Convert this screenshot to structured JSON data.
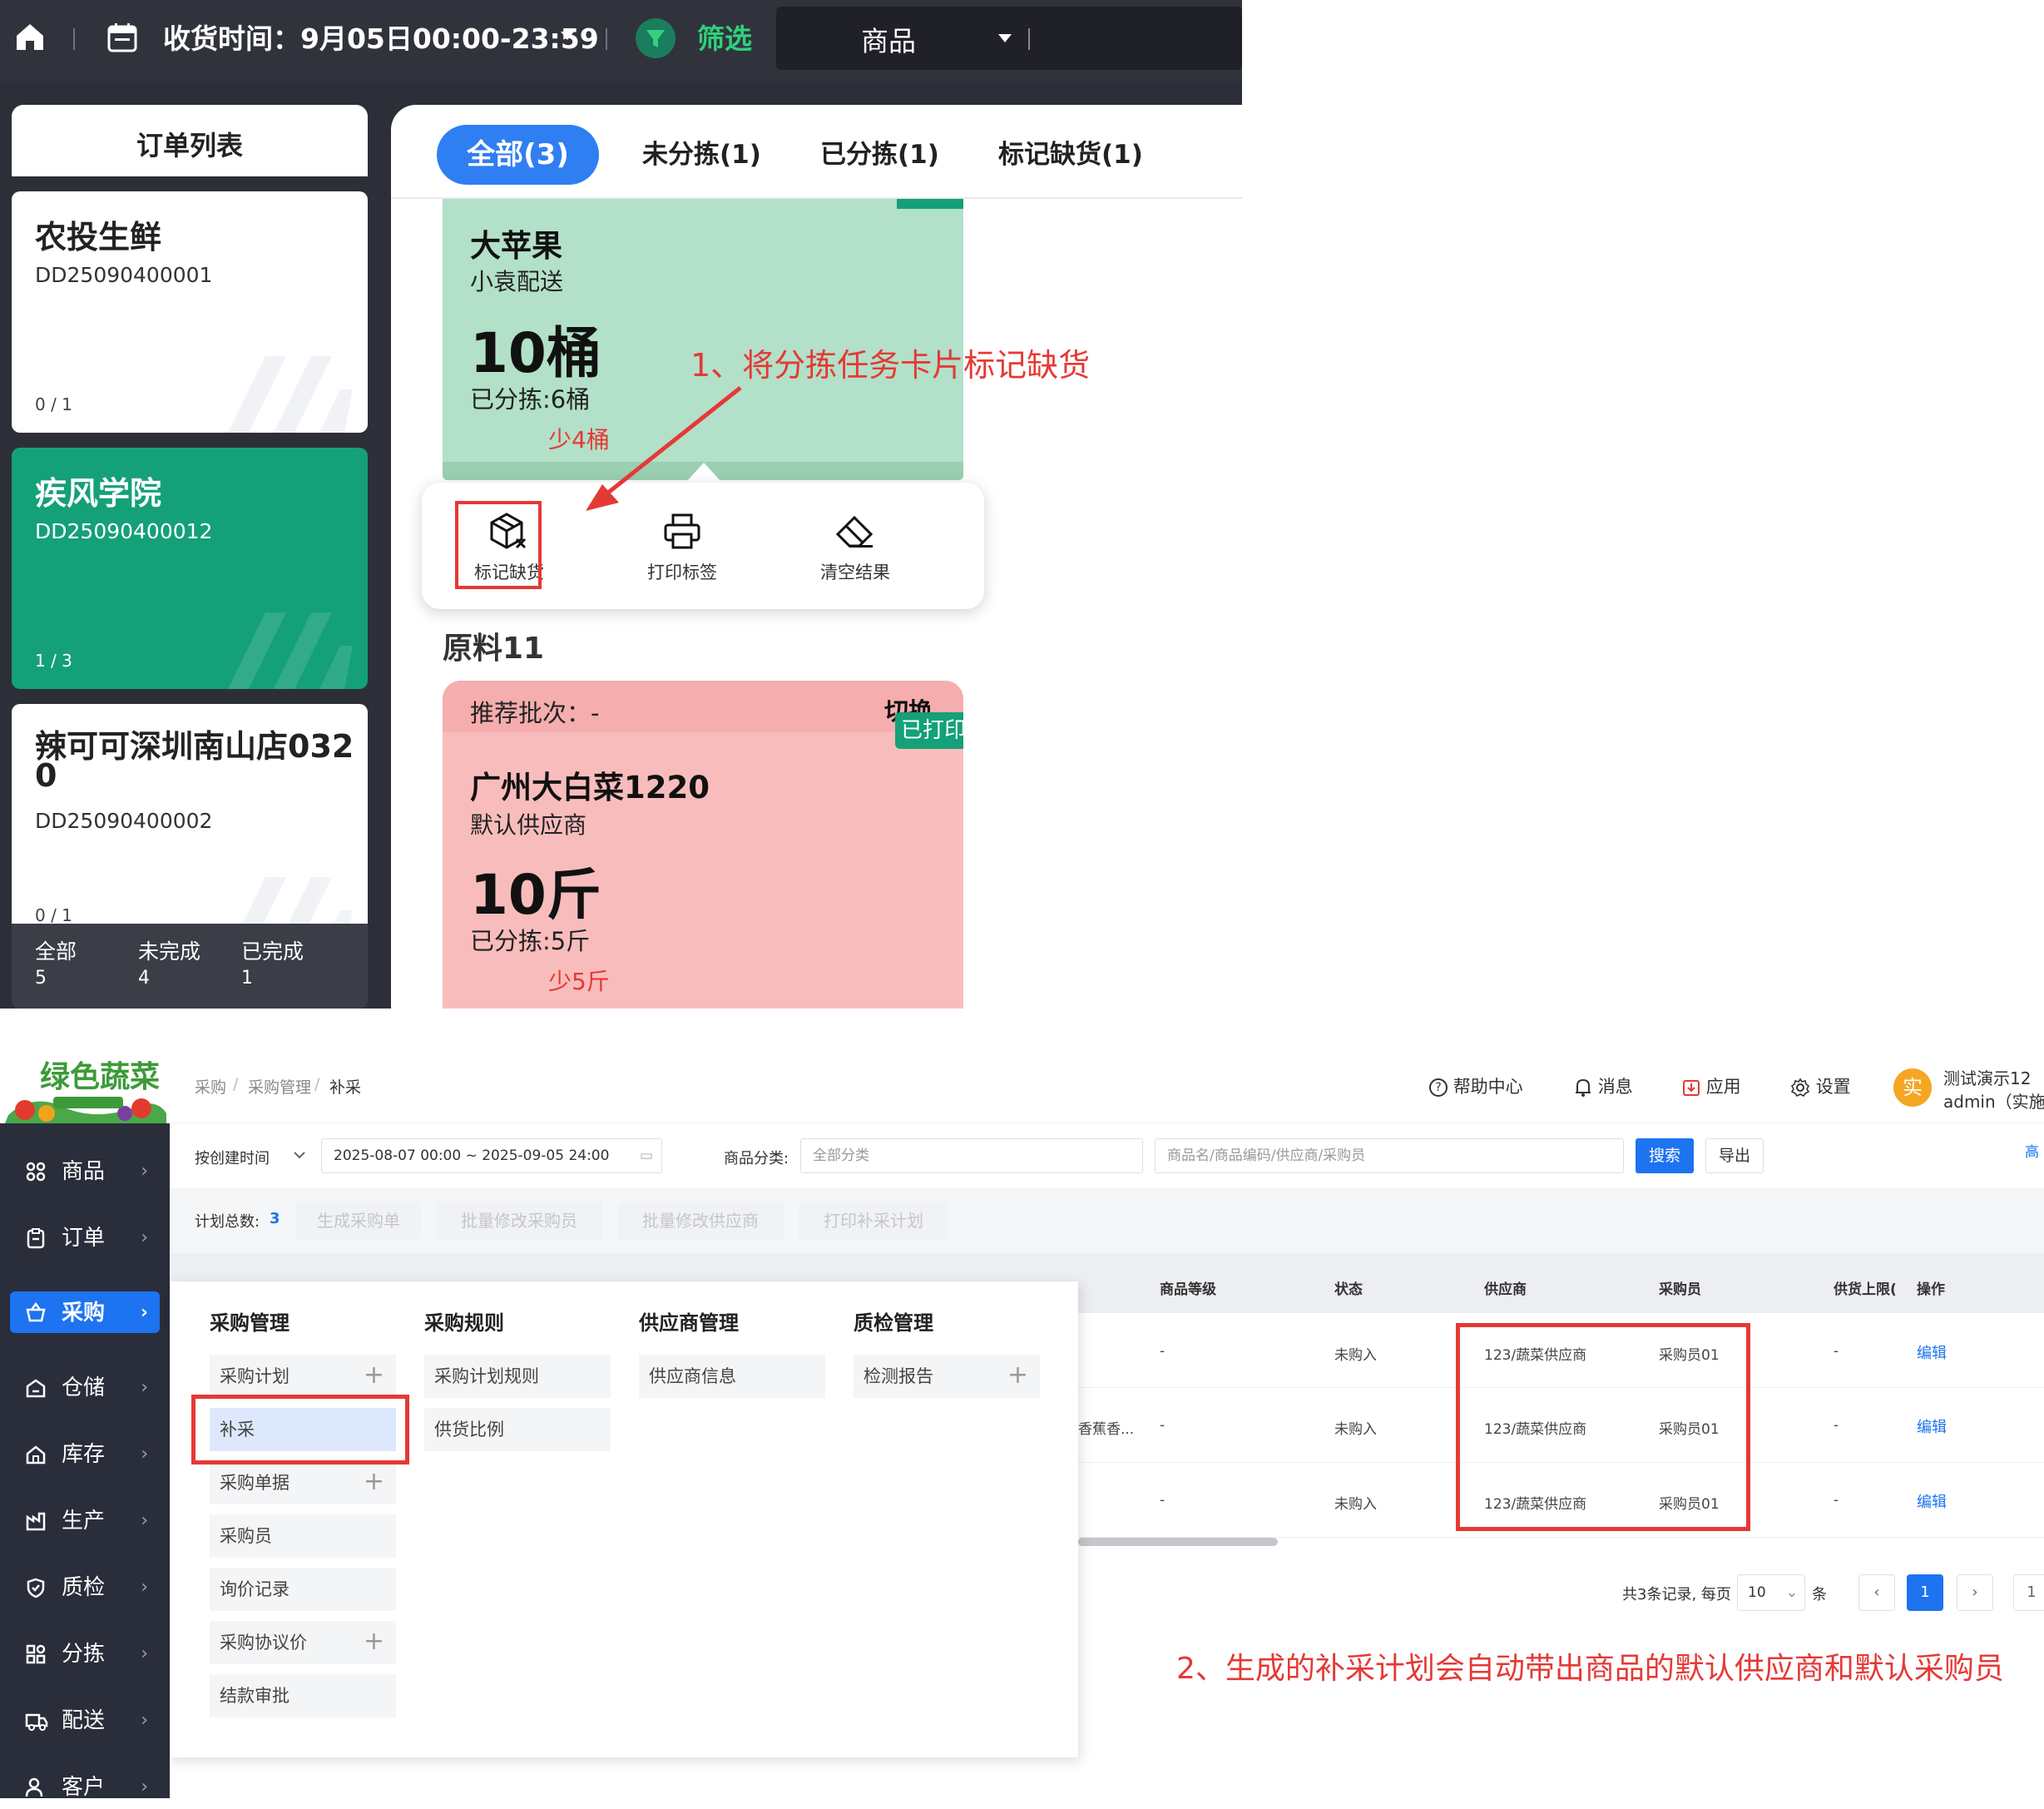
{
  "top": {
    "receive_time_label": "收货时间：9月05日00:00-23:59",
    "filter_label": "筛选",
    "goods_dropdown": "商品",
    "order_list_title": "订单列表",
    "orders": [
      {
        "name": "农投生鲜",
        "code": "DD25090400001",
        "progress": "0 / 1",
        "active": false
      },
      {
        "name": "疾风学院",
        "code": "DD25090400012",
        "progress": "1 / 3",
        "active": true
      },
      {
        "name_line1": "辣可可深圳南山店032",
        "name_line2": "0",
        "code": "DD25090400002",
        "progress": "0 / 1",
        "active": false
      }
    ],
    "footer": [
      {
        "label": "全部",
        "value": "5"
      },
      {
        "label": "未完成",
        "value": "4"
      },
      {
        "label": "已完成",
        "value": "1"
      }
    ],
    "tabs": [
      {
        "label": "全部(3)",
        "active": true
      },
      {
        "label": "未分拣(1)",
        "active": false
      },
      {
        "label": "已分拣(1)",
        "active": false
      },
      {
        "label": "标记缺货(1)",
        "active": false
      }
    ],
    "card1": {
      "title": "大苹果",
      "sub": "小袁配送",
      "qty": "10桶",
      "sorted": "已分拣:6桶",
      "short": "少4桶"
    },
    "annotation1": "1、将分拣任务卡片标记缺货",
    "popup": {
      "mark_short": "标记缺货",
      "print_label": "打印标签",
      "clear_result": "清空结果"
    },
    "section_title": "原料11",
    "card2": {
      "batch": "推荐批次：-",
      "switch": "切换",
      "printed_badge": "已打印",
      "title": "广州大白菜1220",
      "sub": "默认供应商",
      "qty": "10斤",
      "sorted": "已分拣:5斤",
      "short": "少5斤"
    }
  },
  "bottom": {
    "breadcrumb": [
      "采购",
      "/",
      "采购管理",
      "/",
      "补采"
    ],
    "header": {
      "help": "帮助中心",
      "messages": "消息",
      "apps": "应用",
      "settings": "设置",
      "avatar_char": "实",
      "user_name": "测试演示12",
      "user_role": "admin（实施"
    },
    "nav": [
      {
        "label": "商品"
      },
      {
        "label": "订单"
      },
      {
        "label": "采购"
      },
      {
        "label": "仓储"
      },
      {
        "label": "库存"
      },
      {
        "label": "生产"
      },
      {
        "label": "质检"
      },
      {
        "label": "分拣"
      },
      {
        "label": "配送"
      },
      {
        "label": "客户"
      }
    ],
    "filters": {
      "time_type": "按创建时间",
      "date_range": "2025-08-07 00:00 ~ 2025-09-05 24:00",
      "category_label": "商品分类:",
      "category_placeholder": "全部分类",
      "search_placeholder": "商品名/商品编码/供应商/采购员",
      "search_btn": "搜索",
      "export_btn": "导出",
      "advanced": "高"
    },
    "toolbar": {
      "plan_total_label": "计划总数:",
      "plan_total_value": "3",
      "buttons": [
        "生成采购单",
        "批量修改采购员",
        "批量修改供应商",
        "打印补采计划"
      ]
    },
    "columns": [
      "商品等级",
      "状态",
      "供应商",
      "采购员",
      "供货上限(",
      "操作"
    ],
    "rows": [
      {
        "partial": "",
        "grade": "-",
        "status": "未购入",
        "supplier": "123/蔬菜供应商",
        "buyer": "采购员01",
        "limit": "-",
        "action": "编辑"
      },
      {
        "partial": "香蕉香...",
        "grade": "-",
        "status": "未购入",
        "supplier": "123/蔬菜供应商",
        "buyer": "采购员01",
        "limit": "-",
        "action": "编辑"
      },
      {
        "partial": "",
        "grade": "-",
        "status": "未购入",
        "supplier": "123/蔬菜供应商",
        "buyer": "采购员01",
        "limit": "-",
        "action": "编辑"
      }
    ],
    "menu": {
      "col1": {
        "title": "采购管理",
        "items": [
          "采购计划",
          "补采",
          "采购单据",
          "采购员",
          "询价记录",
          "采购协议价",
          "结款审批"
        ]
      },
      "col2": {
        "title": "采购规则",
        "items": [
          "采购计划规则",
          "供货比例"
        ]
      },
      "col3": {
        "title": "供应商管理",
        "items": [
          "供应商信息"
        ]
      },
      "col4": {
        "title": "质检管理",
        "items": [
          "检测报告"
        ]
      }
    },
    "pagination": {
      "summary": "共3条记录, 每页",
      "page_size": "10",
      "unit": "条",
      "current": "1",
      "last": "1"
    },
    "annotation2": "2、生成的补采计划会自动带出商品的默认供应商和默认采购员"
  },
  "colors": {
    "accent_blue": "#2f7ff2",
    "green_active": "#14a078",
    "card_green": "#b2e0c8",
    "card_pink": "#f9bcbc",
    "annotation_red": "#e53935"
  }
}
